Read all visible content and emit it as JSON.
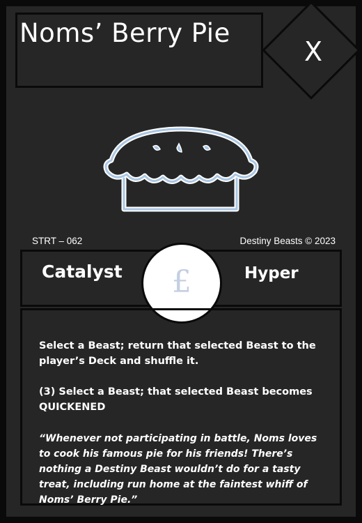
{
  "card": {
    "title": "Noms’ Berry Pie",
    "cost": "X",
    "art_icon": "pie-icon",
    "set_code": "STRT – 062",
    "copyright": "Destiny Beasts © 2023",
    "type_left": "Catalyst",
    "type_right": "Hyper",
    "currency_symbol": "£",
    "effect_1": "Select a Beast; return that selected Beast to the player’s Deck and shuffle it.",
    "effect_2": "(3) Select a Beast; that selected Beast becomes QUICKENED",
    "flavor": "“Whenever not participating in battle, Noms loves to cook his famous pie for his friends! There’s nothing a Destiny Beast wouldn’t do for a tasty treat, including run home at the faintest whiff of Noms’ Berry Pie.”"
  },
  "colors": {
    "card_bg": "#262626",
    "border": "#0a0a0a",
    "art_outline": "#ffffff",
    "art_inner": "#a9c6e3",
    "currency_symbol": "#c4cfe1"
  }
}
